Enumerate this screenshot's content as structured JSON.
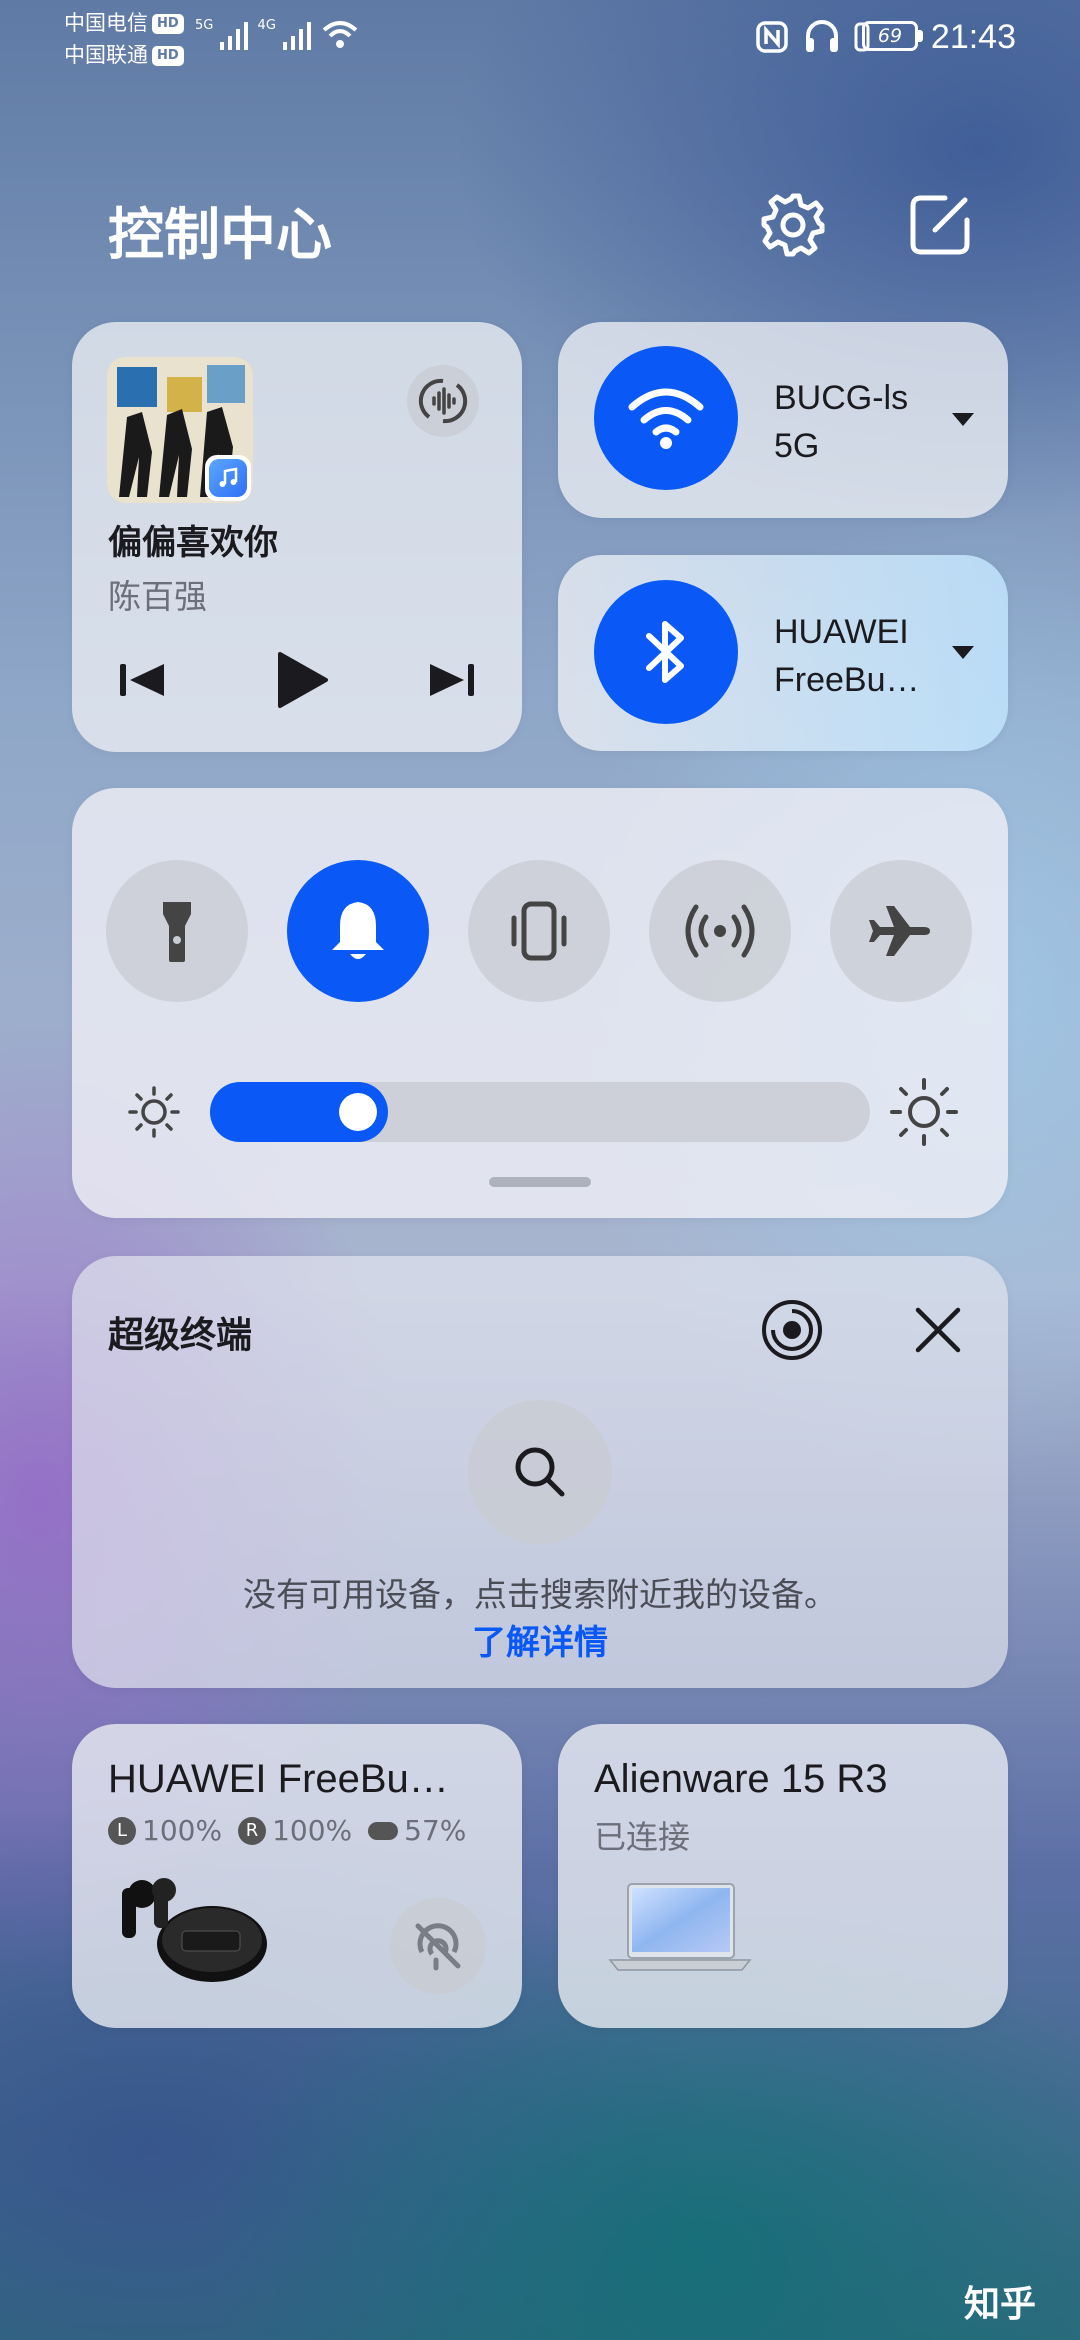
{
  "status_bar": {
    "carrier1": "中国电信",
    "carrier2": "中国联通",
    "hd": "HD",
    "net1": "5G",
    "net2": "4G",
    "battery": "69",
    "time": "21:43"
  },
  "header": {
    "title": "控制中心",
    "settings_icon": "gear-icon",
    "edit_icon": "edit-icon"
  },
  "media": {
    "song": "偏偏喜欢你",
    "artist": "陈百强"
  },
  "wifi": {
    "label": "BUCG-ls\n5G",
    "line1": "BUCG-ls",
    "line2": "5G"
  },
  "bluetooth": {
    "line1": "HUAWEI",
    "line2": "FreeBu…"
  },
  "toggles": [
    {
      "icon": "flashlight-icon",
      "active": false
    },
    {
      "icon": "bell-icon",
      "active": true
    },
    {
      "icon": "vibrate-icon",
      "active": false
    },
    {
      "icon": "hotspot-icon",
      "active": false
    },
    {
      "icon": "airplane-icon",
      "active": false
    }
  ],
  "brightness": {
    "level": 0.27
  },
  "super_device": {
    "title": "超级终端",
    "hint": "没有可用设备，点击搜索附近我的设备。",
    "link": "了解详情"
  },
  "devices": {
    "earbuds": {
      "name": "HUAWEI FreeBu…",
      "left_label": "L",
      "left": "100%",
      "right_label": "R",
      "right": "100%",
      "case": "57%"
    },
    "laptop": {
      "name": "Alienware 15 R3",
      "status": "已连接"
    }
  },
  "watermark": "知乎",
  "colors": {
    "accent": "#0a59f7",
    "card": "rgba(236,238,244,0.78)"
  }
}
